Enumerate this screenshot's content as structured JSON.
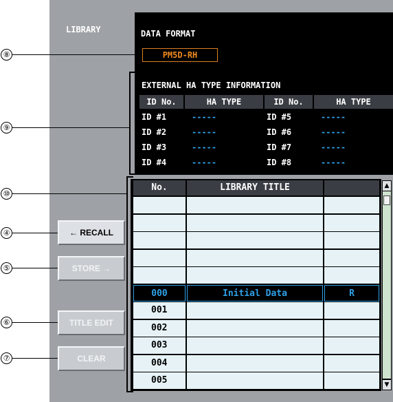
{
  "library_label": "LIBRARY",
  "data_format": {
    "label": "DATA FORMAT",
    "value": "PM5D-RH"
  },
  "external_ha": {
    "title": "EXTERNAL HA TYPE INFORMATION",
    "headers": [
      "ID No.",
      "HA TYPE",
      "ID No.",
      "HA TYPE"
    ],
    "rows": [
      [
        "ID #1",
        "-----",
        "ID #5",
        "-----"
      ],
      [
        "ID #2",
        "-----",
        "ID #6",
        "-----"
      ],
      [
        "ID #3",
        "-----",
        "ID #7",
        "-----"
      ],
      [
        "ID #4",
        "-----",
        "ID #8",
        "-----"
      ]
    ]
  },
  "buttons": {
    "recall": "← RECALL",
    "store": "STORE →",
    "title_edit": "TITLE EDIT",
    "clear": "CLEAR"
  },
  "library_table": {
    "headers": [
      "No.",
      "LIBRARY TITLE",
      ""
    ],
    "rows": [
      [
        "",
        "",
        ""
      ],
      [
        "",
        "",
        ""
      ],
      [
        "",
        "",
        ""
      ],
      [
        "",
        "",
        ""
      ],
      [
        "",
        "",
        ""
      ],
      [
        "000",
        "Initial Data",
        "R"
      ],
      [
        "001",
        "",
        ""
      ],
      [
        "002",
        "",
        ""
      ],
      [
        "003",
        "",
        ""
      ],
      [
        "004",
        "",
        ""
      ],
      [
        "005",
        "",
        ""
      ]
    ],
    "selected_row": 5
  },
  "callouts": [
    "⑧",
    "⑨",
    "⑩",
    "④",
    "⑤",
    "⑥",
    "⑦"
  ],
  "colors": {
    "accent_orange": "#f08a20",
    "accent_blue": "#2ea0e6",
    "panel_gray": "#9ea2a6"
  }
}
